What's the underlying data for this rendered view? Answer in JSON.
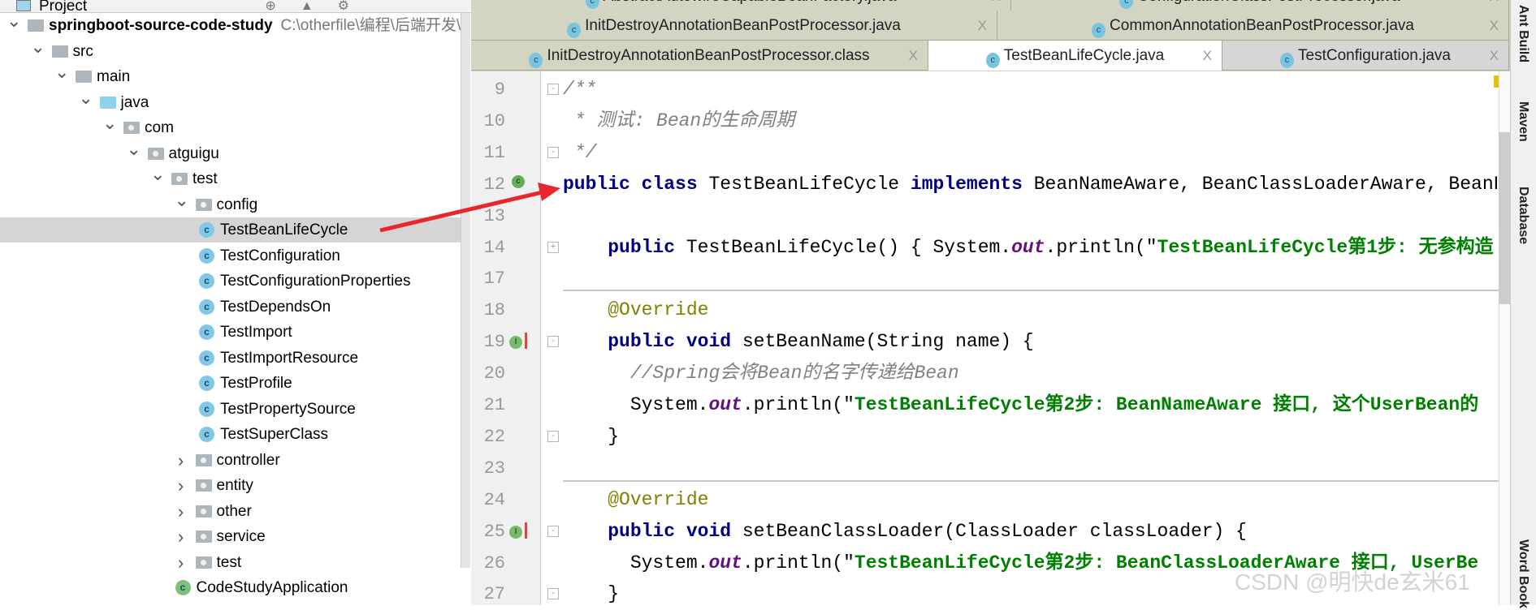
{
  "project_panel": {
    "title": "Project",
    "items": [
      {
        "level": 0,
        "arrow": "down",
        "icon": "module",
        "label": "springboot-source-code-study",
        "path": "C:\\otherfile\\编程\\后端开发\\(",
        "bold": true
      },
      {
        "level": 1,
        "arrow": "down",
        "icon": "folder",
        "label": "src"
      },
      {
        "level": 2,
        "arrow": "down",
        "icon": "folder",
        "label": "main"
      },
      {
        "level": 3,
        "arrow": "down",
        "icon": "source-folder",
        "label": "java"
      },
      {
        "level": 4,
        "arrow": "down",
        "icon": "package",
        "label": "com"
      },
      {
        "level": 5,
        "arrow": "down",
        "icon": "package",
        "label": "atguigu"
      },
      {
        "level": 6,
        "arrow": "down",
        "icon": "package",
        "label": "test"
      },
      {
        "level": 7,
        "arrow": "down",
        "icon": "package",
        "label": "config"
      },
      {
        "level": 8,
        "icon": "class",
        "label": "TestBeanLifeCycle",
        "selected": true
      },
      {
        "level": 8,
        "icon": "class",
        "label": "TestConfiguration"
      },
      {
        "level": 8,
        "icon": "class",
        "label": "TestConfigurationProperties"
      },
      {
        "level": 8,
        "icon": "class",
        "label": "TestDependsOn"
      },
      {
        "level": 8,
        "icon": "class",
        "label": "TestImport"
      },
      {
        "level": 8,
        "icon": "class",
        "label": "TestImportResource"
      },
      {
        "level": 8,
        "icon": "class",
        "label": "TestProfile"
      },
      {
        "level": 8,
        "icon": "class",
        "label": "TestPropertySource"
      },
      {
        "level": 8,
        "icon": "class",
        "label": "TestSuperClass"
      },
      {
        "level": 7,
        "arrow": "right",
        "icon": "package",
        "label": "controller"
      },
      {
        "level": 7,
        "arrow": "right",
        "icon": "package",
        "label": "entity"
      },
      {
        "level": 7,
        "arrow": "right",
        "icon": "package",
        "label": "other"
      },
      {
        "level": 7,
        "arrow": "right",
        "icon": "package",
        "label": "service"
      },
      {
        "level": 7,
        "arrow": "right",
        "icon": "package",
        "label": "test"
      },
      {
        "level": 7,
        "icon": "spring-boot-class",
        "label": "CodeStudyApplication"
      }
    ]
  },
  "tabs": {
    "row1": [
      {
        "label": "AbstractAutowireCapableBeanFactory.java"
      },
      {
        "label": "ConfigurationClassPostProcessor.java"
      }
    ],
    "row2": [
      {
        "label": "InitDestroyAnnotationBeanPostProcessor.java"
      },
      {
        "label": "CommonAnnotationBeanPostProcessor.java"
      }
    ],
    "row3": [
      {
        "label": "InitDestroyAnnotationBeanPostProcessor.class"
      },
      {
        "label": "TestBeanLifeCycle.java",
        "active": true
      },
      {
        "label": "TestConfiguration.java"
      }
    ],
    "close_glyph": "X"
  },
  "editor": {
    "lines": [
      {
        "n": "9",
        "tokens": [
          [
            "cm",
            "/**"
          ]
        ]
      },
      {
        "n": "10",
        "tokens": [
          [
            "cm",
            " * 测试: Bean的生命周期"
          ]
        ]
      },
      {
        "n": "11",
        "tokens": [
          [
            "cm",
            " */"
          ]
        ]
      },
      {
        "n": "12",
        "tokens": [
          [
            "kw",
            "public"
          ],
          [
            "",
            ""
          ],
          [
            "",
            ""
          ],
          [
            "kw",
            " class"
          ],
          [
            "",
            " TestBeanLifeCycle "
          ],
          [
            "kw",
            "implements"
          ],
          [
            "",
            " BeanNameAware, BeanClassLoaderAware, BeanFactoryAware"
          ]
        ]
      },
      {
        "n": "13",
        "tokens": []
      },
      {
        "n": "14",
        "tokens": [
          [
            "",
            "    "
          ],
          [
            "kw",
            "public"
          ],
          [
            "",
            " TestBeanLifeCycle() { System."
          ],
          [
            "fd",
            "out"
          ],
          [
            "",
            ".println(\""
          ],
          [
            "st",
            "TestBeanLifeCycle第1步: 无参构造"
          ]
        ]
      },
      {
        "n": "17",
        "tokens": []
      },
      {
        "n": "18",
        "tokens": [
          [
            "",
            "    "
          ],
          [
            "an",
            "@Override"
          ]
        ]
      },
      {
        "n": "19",
        "tokens": [
          [
            "",
            "    "
          ],
          [
            "kw",
            "public void"
          ],
          [
            "",
            " setBeanName(String name) {"
          ]
        ]
      },
      {
        "n": "20",
        "tokens": [
          [
            "",
            "      "
          ],
          [
            "cm",
            "//Spring会将Bean的名字传递给Bean"
          ]
        ]
      },
      {
        "n": "21",
        "tokens": [
          [
            "",
            "      System."
          ],
          [
            "fd",
            "out"
          ],
          [
            "",
            ".println(\""
          ],
          [
            "st",
            "TestBeanLifeCycle第2步: BeanNameAware 接口, 这个UserBean的"
          ]
        ]
      },
      {
        "n": "22",
        "tokens": [
          [
            "",
            "    }"
          ]
        ]
      },
      {
        "n": "23",
        "tokens": []
      },
      {
        "n": "24",
        "tokens": [
          [
            "",
            "    "
          ],
          [
            "an",
            "@Override"
          ]
        ]
      },
      {
        "n": "25",
        "tokens": [
          [
            "",
            "    "
          ],
          [
            "kw",
            "public void"
          ],
          [
            "",
            " setBeanClassLoader(ClassLoader classLoader) {"
          ]
        ]
      },
      {
        "n": "26",
        "tokens": [
          [
            "",
            "      System."
          ],
          [
            "fd",
            "out"
          ],
          [
            "",
            ".println(\""
          ],
          [
            "st",
            "TestBeanLifeCycle第2步: BeanClassLoaderAware 接口, UserBe"
          ]
        ]
      },
      {
        "n": "27",
        "tokens": [
          [
            "",
            "    }"
          ]
        ]
      }
    ]
  },
  "right_toolbar": [
    "Ant Build",
    "Maven",
    "Database",
    "Word Book"
  ],
  "watermark": "CSDN @明快de玄米61",
  "colors": {
    "keyword": "#000080",
    "string": "#008000",
    "comment": "#808080",
    "annotation": "#808000",
    "annotation_arrow": "#e8262b"
  }
}
